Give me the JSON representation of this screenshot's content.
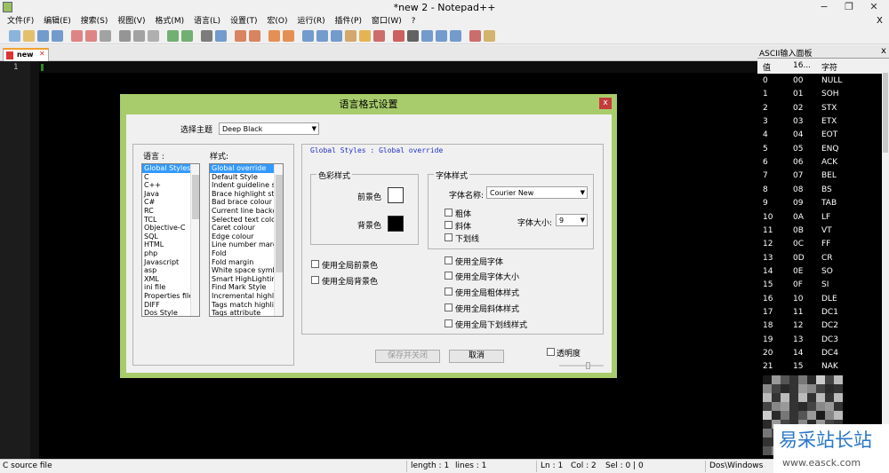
{
  "window": {
    "title": "*new  2 - Notepad++",
    "min": "−",
    "max": "❐",
    "close": "✕",
    "doc_close": "X"
  },
  "menu": [
    "文件(F)",
    "编辑(E)",
    "搜索(S)",
    "视图(V)",
    "格式(M)",
    "语言(L)",
    "设置(T)",
    "宏(O)",
    "运行(R)",
    "插件(P)",
    "窗口(W)",
    "?"
  ],
  "toolbar_icons": [
    "new-icon",
    "open-icon",
    "save-icon",
    "save-all-icon",
    "close-icon",
    "close-all-icon",
    "print-icon",
    "cut-icon",
    "copy-icon",
    "paste-icon",
    "undo-icon",
    "redo-icon",
    "find-icon",
    "replace-icon",
    "zoom-in-icon",
    "zoom-out-icon",
    "sync-v-icon",
    "sync-h-icon",
    "wrap-icon",
    "all-chars-icon",
    "indent-guide-icon",
    "udl-icon",
    "doc-map-icon",
    "function-list-icon",
    "record-icon",
    "stop-icon",
    "play-icon",
    "play-multi-icon",
    "save-macro-icon",
    "spellcheck-icon",
    "abc-icon"
  ],
  "tab": {
    "label": "new",
    "close": "✕"
  },
  "editor": {
    "line_number": "1"
  },
  "ascii_panel": {
    "title": "ASCII输入面板",
    "close": "x",
    "headers": [
      "值",
      "16...",
      "字符"
    ],
    "rows": [
      [
        "0",
        "00",
        "NULL"
      ],
      [
        "1",
        "01",
        "SOH"
      ],
      [
        "2",
        "02",
        "STX"
      ],
      [
        "3",
        "03",
        "ETX"
      ],
      [
        "4",
        "04",
        "EOT"
      ],
      [
        "5",
        "05",
        "ENQ"
      ],
      [
        "6",
        "06",
        "ACK"
      ],
      [
        "7",
        "07",
        "BEL"
      ],
      [
        "8",
        "08",
        "BS"
      ],
      [
        "9",
        "09",
        "TAB"
      ],
      [
        "10",
        "0A",
        "LF"
      ],
      [
        "11",
        "0B",
        "VT"
      ],
      [
        "12",
        "0C",
        "FF"
      ],
      [
        "13",
        "0D",
        "CR"
      ],
      [
        "14",
        "0E",
        "SO"
      ],
      [
        "15",
        "0F",
        "SI"
      ],
      [
        "16",
        "10",
        "DLE"
      ],
      [
        "17",
        "11",
        "DC1"
      ],
      [
        "18",
        "12",
        "DC2"
      ],
      [
        "19",
        "13",
        "DC3"
      ],
      [
        "20",
        "14",
        "DC4"
      ],
      [
        "21",
        "15",
        "NAK"
      ]
    ]
  },
  "dialog": {
    "title": "语言格式设置",
    "close": "x",
    "theme_label": "选择主题",
    "theme_value": "Deep Black",
    "language_label": "语言 :",
    "style_label": "样式:",
    "languages": [
      "Global Styles",
      "C",
      "C++",
      "Java",
      "C#",
      "RC",
      "TCL",
      "Objective-C",
      "SQL",
      "HTML",
      "php",
      "Javascript",
      "asp",
      "XML",
      "ini file",
      "Properties file",
      "DIFF",
      "Dos Style"
    ],
    "styles": [
      "Global override",
      "Default Style",
      "Indent guideline style",
      "Brace highlight style",
      "Bad brace colour",
      "Current line background",
      "Selected text colour",
      "Caret colour",
      "Edge colour",
      "Line number margin",
      "Fold",
      "Fold margin",
      "White space symbol",
      "Smart HighLighting",
      "Find Mark Style",
      "Incremental highlight",
      "Tags match highlighting",
      "Tags attribute"
    ],
    "breadcrumb": "Global Styles : Global override",
    "colour_group": "色彩样式",
    "fg_label": "前景色",
    "bg_label": "背景色",
    "font_group": "字体样式",
    "font_name_label": "字体名称:",
    "font_name_value": "Courier New",
    "bold": "粗体",
    "italic": "斜体",
    "underline": "下划线",
    "font_size_label": "字体大小:",
    "font_size_value": "9",
    "global_fg": "使用全局前景色",
    "global_bg": "使用全局背景色",
    "global_font": "使用全局字体",
    "global_size": "使用全局字体大小",
    "global_bold": "使用全局粗体样式",
    "global_italic": "使用全局斜体样式",
    "global_underline": "使用全局下划线样式",
    "save_close": "保存并关闭",
    "cancel": "取消",
    "transparency": "透明度",
    "colors": {
      "fg": "#ffffff",
      "bg": "#000000",
      "title_bar": "#a8cc6c"
    }
  },
  "status": {
    "file_type": "C source file",
    "length": "length : 1",
    "lines": "lines : 1",
    "ln": "Ln : 1",
    "col": "Col : 2",
    "sel": "Sel : 0 | 0",
    "eol": "Dos\\Windows"
  },
  "watermark": {
    "name": "易采站长站",
    "url": "www.easck.com"
  }
}
